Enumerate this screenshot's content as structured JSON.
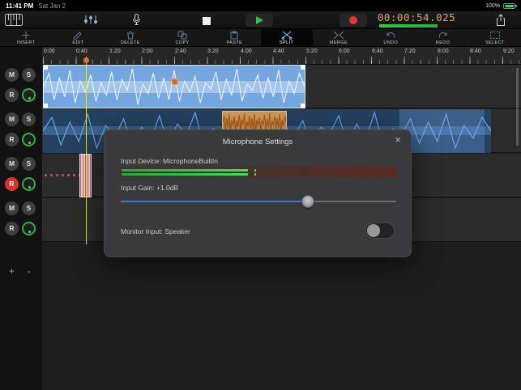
{
  "status_bar": {
    "time": "11:41 PM",
    "date": "Sat Jan 2",
    "battery_percent": "100%"
  },
  "transport": {
    "timecode": "00:00:54.025",
    "progress_pct": 78
  },
  "edit_toolbar": {
    "items": [
      {
        "label": "INSERT",
        "icon": "plus-icon"
      },
      {
        "label": "EDIT",
        "icon": "pencil-icon"
      },
      {
        "label": "DELETE",
        "icon": "trash-icon"
      },
      {
        "label": "COPY",
        "icon": "copy-icon"
      },
      {
        "label": "PASTE",
        "icon": "paste-icon"
      },
      {
        "label": "SPLIT",
        "icon": "scissors-icon",
        "active": true
      },
      {
        "label": "MERGE",
        "icon": "merge-icon"
      },
      {
        "label": "UNDO",
        "icon": "undo-icon"
      },
      {
        "label": "REDO",
        "icon": "redo-icon"
      },
      {
        "label": "SELECT",
        "icon": "select-icon"
      }
    ]
  },
  "timeline": {
    "ticks": [
      "0:00",
      "0:40",
      "1:20",
      "2:00",
      "2:40",
      "3:20",
      "4:00",
      "4:40",
      "5:20",
      "6:00",
      "6:40",
      "7:20",
      "8:00",
      "8:40",
      "9:20"
    ]
  },
  "track_panel": {
    "mute_label": "M",
    "solo_label": "S",
    "record_label": "R",
    "add_label": "+",
    "remove_label": "-",
    "armed_track_index": 2
  },
  "modal": {
    "title": "Microphone Settings",
    "close_label": "×",
    "input_device_label": "Input Device: MicrophoneBuiltIn",
    "input_gain_label": "Input Gain: +1.0dB",
    "monitor_label": "Monitor Input: Speaker",
    "meter_level_pct": 46,
    "gain_pct": 68,
    "monitor_on": false
  },
  "colors": {
    "accent_blue": "#3d7cd8",
    "waveform_blue": "#6ba3e8",
    "selected_clip_blue": "#74a7e0",
    "record_red": "#e5372b",
    "play_green": "#35c24a",
    "timecode_orange": "#ffa21f",
    "playhead_yellow": "#d9e34c",
    "meter_green": "#3fe05a",
    "selection_orange": "#c89a5a"
  }
}
